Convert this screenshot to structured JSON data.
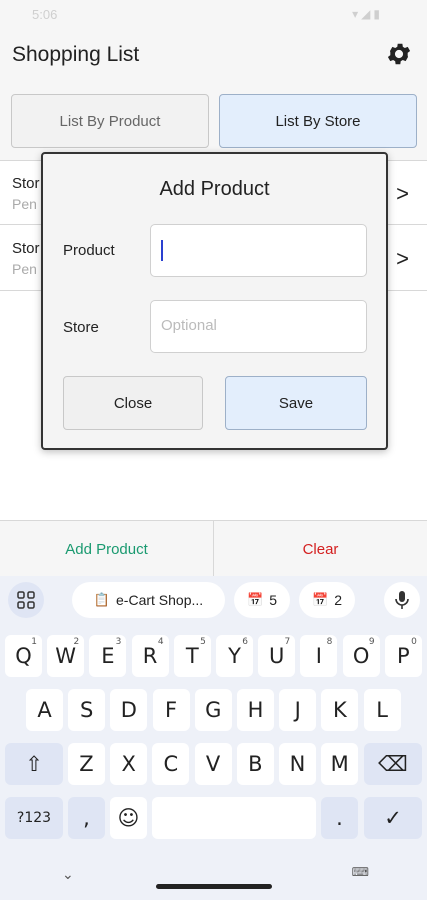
{
  "status_bar": {
    "time": "5:06",
    "icons": "▾◢▮"
  },
  "app_bar": {
    "title": "Shopping List",
    "settings_icon": "gear-icon"
  },
  "tabs": [
    {
      "label": "List By Product"
    },
    {
      "label": "List By Store"
    }
  ],
  "list": {
    "rows": [
      {
        "name": "Stor",
        "sub": "Pen"
      },
      {
        "name": "Stor",
        "sub": "Pen"
      }
    ],
    "chevron": ">"
  },
  "dialog": {
    "title": "Add Product",
    "product_label": "Product",
    "product_value": "",
    "store_label": "Store",
    "store_placeholder": "Optional",
    "close_label": "Close",
    "save_label": "Save"
  },
  "actions": {
    "add_label": "Add Product",
    "clear_label": "Clear",
    "add_color": "#1a9a70",
    "clear_color": "#d42020"
  },
  "keyboard": {
    "suggestions": {
      "app_chip": "e-Cart Shop...",
      "clip1": "5",
      "clip2": "2"
    },
    "row1": [
      {
        "k": "Q",
        "n": "1"
      },
      {
        "k": "W",
        "n": "2"
      },
      {
        "k": "E",
        "n": "3"
      },
      {
        "k": "R",
        "n": "4"
      },
      {
        "k": "T",
        "n": "5"
      },
      {
        "k": "Y",
        "n": "6"
      },
      {
        "k": "U",
        "n": "7"
      },
      {
        "k": "I",
        "n": "8"
      },
      {
        "k": "O",
        "n": "9"
      },
      {
        "k": "P",
        "n": "0"
      }
    ],
    "row2": [
      "A",
      "S",
      "D",
      "F",
      "G",
      "H",
      "J",
      "K",
      "L"
    ],
    "row3": [
      "Z",
      "X",
      "C",
      "V",
      "B",
      "N",
      "M"
    ],
    "row4": {
      "sym": "?123",
      "comma": ",",
      "period": "."
    },
    "accent_color": "#dfe5f4"
  }
}
